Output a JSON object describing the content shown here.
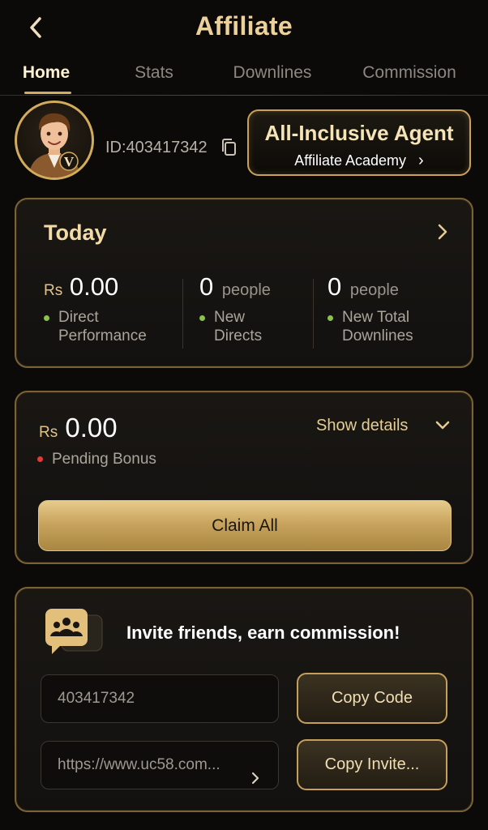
{
  "header": {
    "title": "Affiliate"
  },
  "tabs": [
    {
      "label": "Home",
      "active": true
    },
    {
      "label": "Stats",
      "active": false
    },
    {
      "label": "Downlines",
      "active": false
    },
    {
      "label": "Commission",
      "active": false
    }
  ],
  "profile": {
    "id_text": "ID:403417342",
    "avatar_badge": "V",
    "agent_title": "All-Inclusive Agent",
    "agent_subtitle": "Affiliate Academy",
    "agent_subtitle_arrow": "›"
  },
  "today": {
    "title": "Today",
    "stats": [
      {
        "prefix": "Rs",
        "value": "0.00",
        "unit": "",
        "label_line1": "Direct",
        "label_line2": "Performance",
        "dot_color": "#8bc34a"
      },
      {
        "prefix": "",
        "value": "0",
        "unit": "people",
        "label_line1": "New",
        "label_line2": "Directs",
        "dot_color": "#8bc34a"
      },
      {
        "prefix": "",
        "value": "0",
        "unit": "people",
        "label_line1": "New Total",
        "label_line2": "Downlines",
        "dot_color": "#8bc34a"
      }
    ]
  },
  "bonus": {
    "prefix": "Rs",
    "value": "0.00",
    "show_details": "Show details",
    "pending_label": "Pending Bonus",
    "pending_dot_color": "#e53935",
    "claim_label": "Claim All"
  },
  "invite": {
    "title": "Invite friends, earn commission!",
    "code_value": "403417342",
    "link_value": "https://www.uc58.com...",
    "copy_code_label": "Copy Code",
    "copy_invite_label": "Copy Invite..."
  },
  "colors": {
    "accent_gold": "#d4ac60",
    "background": "#0b0a09"
  }
}
